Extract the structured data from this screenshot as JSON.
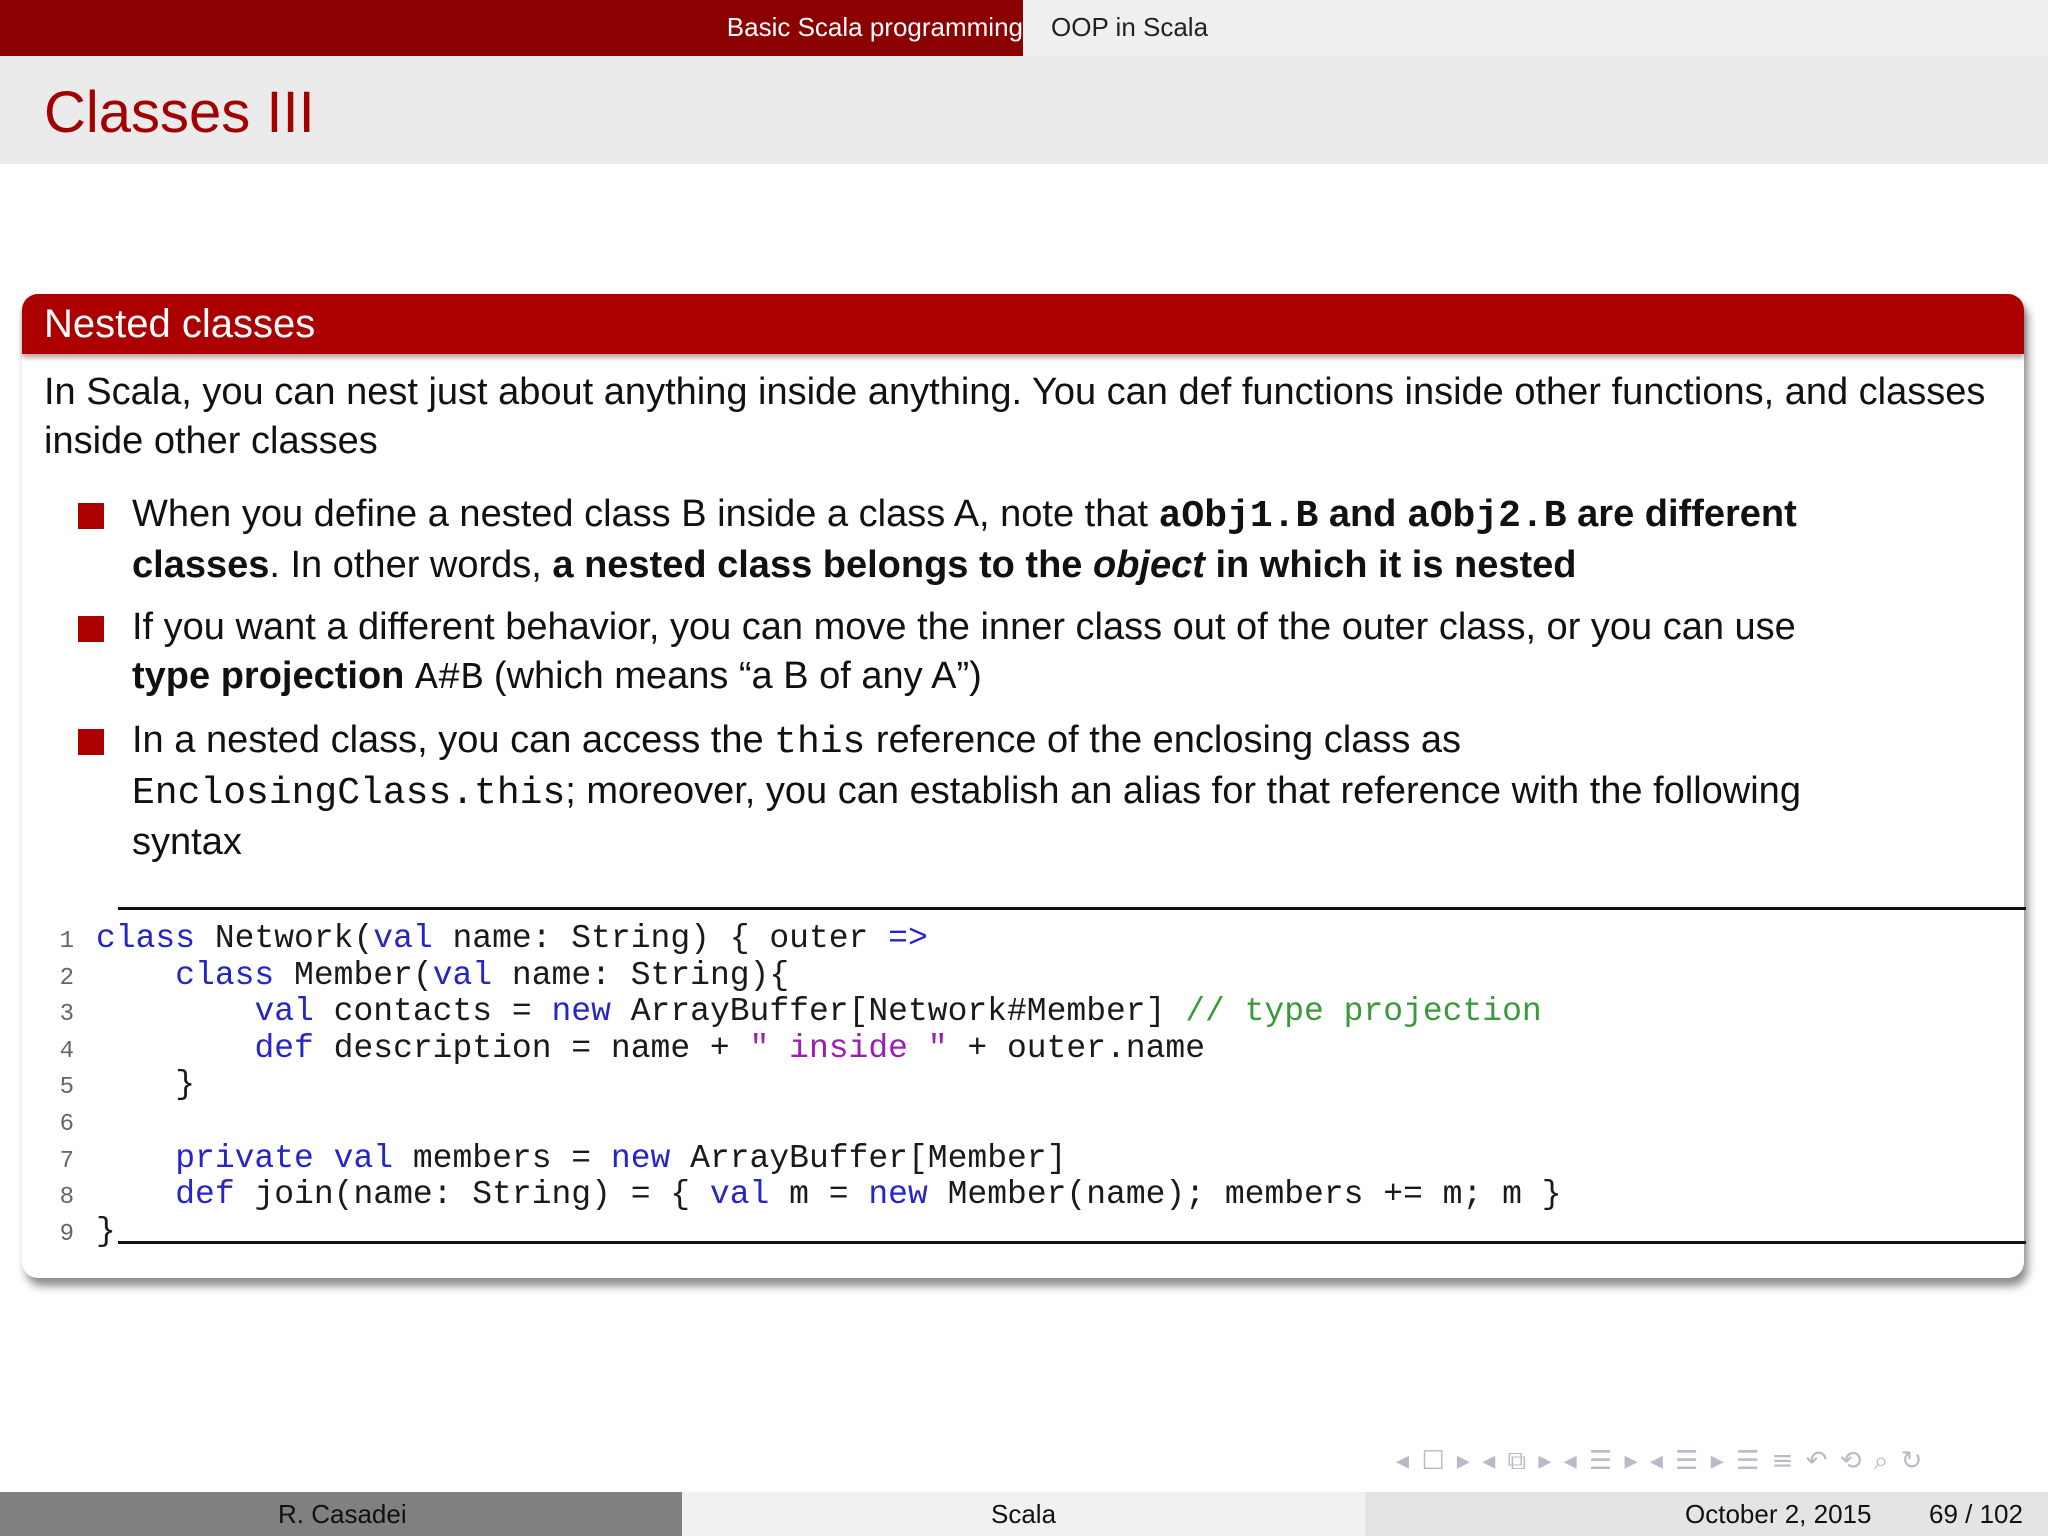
{
  "nav": {
    "sections": [
      "Basic Scala programming",
      "OOP in Scala"
    ]
  },
  "frame": {
    "title": "Classes III"
  },
  "block": {
    "title": "Nested classes",
    "intro": "In Scala, you can nest just about anything inside anything. You can def functions inside other functions, and classes inside other classes",
    "items": [
      {
        "l1_a": "When you define a nested class B inside a class A, note that ",
        "l1_code1": "aObj1.B",
        "l1_b": " and ",
        "l1_code2": "aObj2.B",
        "l1_c": " are different",
        "l2_a": "classes",
        "l2_b": ". In other words, ",
        "l2_c": "a nested class belongs to the ",
        "l2_d": "object",
        "l2_e": " in which it is nested"
      },
      {
        "l1": "If you want a different behavior, you can move the inner class out of the outer class, or you can use",
        "l2_a": "type projection",
        "l2_code": "A#B",
        "l2_b": " (which means “a B of any A”)"
      },
      {
        "l1_a": "In a nested class, you can access the ",
        "l1_code": "this",
        "l1_b": " reference of the enclosing class as",
        "l2_code": "EnclosingClass.this",
        "l2_b": "; moreover, you can establish an alias for that reference with the following",
        "l3": "syntax"
      }
    ]
  },
  "code": {
    "line_numbers": [
      "1",
      "2",
      "3",
      "4",
      "5",
      "6",
      "7",
      "8",
      "9"
    ],
    "l1": {
      "kw1": "class",
      "t1": " Network(",
      "kw2": "val",
      "t2": " name: String) { outer ",
      "kw3": "=>"
    },
    "l2": {
      "indent": "    ",
      "kw1": "class",
      "t1": " Member(",
      "kw2": "val",
      "t2": " name: String){"
    },
    "l3": {
      "indent": "        ",
      "kw1": "val",
      "t1": " contacts = ",
      "kw2": "new",
      "t2": " ArrayBuffer[Network#Member] ",
      "cm": "// type projection"
    },
    "l4": {
      "indent": "        ",
      "kw1": "def",
      "t1": " description = name + ",
      "st": "\" inside \"",
      "t2": " + outer.name"
    },
    "l5": {
      "text": "    }"
    },
    "l6": {
      "text": ""
    },
    "l7": {
      "indent": "    ",
      "kw1": "private",
      "sp": " ",
      "kw2": "val",
      "t1": " members = ",
      "kw3": "new",
      "t2": " ArrayBuffer[Member]"
    },
    "l8": {
      "indent": "    ",
      "kw1": "def",
      "t1": " join(name: String) = { ",
      "kw2": "val",
      "t2": " m = ",
      "kw3": "new",
      "t3": " Member(name); members += m; m }"
    },
    "l9": {
      "text": "}"
    }
  },
  "beamer_nav_icons": "◂ ☐ ▸  ◂ ⧉ ▸  ◂ ☰ ▸  ◂ ☰ ▸  ☰ ≡  ↶ ⟲ ⌕ ↻",
  "footer": {
    "author": "R. Casadei",
    "short_title": "Scala",
    "date": "October 2, 2015",
    "page": "69 / 102"
  }
}
